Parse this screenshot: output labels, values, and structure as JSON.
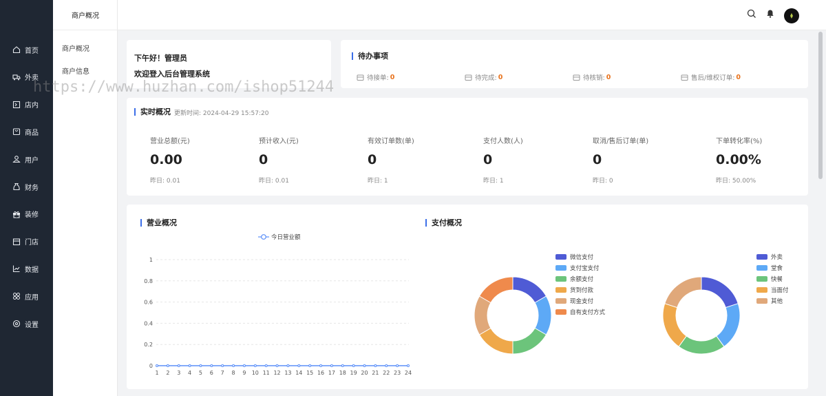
{
  "sidebar": {
    "items": [
      {
        "label": "首页",
        "icon": "home-icon"
      },
      {
        "label": "外卖",
        "icon": "delivery-icon"
      },
      {
        "label": "店内",
        "icon": "store-icon"
      },
      {
        "label": "商品",
        "icon": "bag-icon"
      },
      {
        "label": "用户",
        "icon": "user-icon"
      },
      {
        "label": "财务",
        "icon": "finance-icon"
      },
      {
        "label": "装修",
        "icon": "gift-icon"
      },
      {
        "label": "门店",
        "icon": "shop-icon"
      },
      {
        "label": "数据",
        "icon": "chart-icon"
      },
      {
        "label": "应用",
        "icon": "apps-icon"
      },
      {
        "label": "设置",
        "icon": "gear-icon"
      }
    ]
  },
  "subnav": {
    "title": "商户概况",
    "items": [
      "商户概况",
      "商户信息"
    ]
  },
  "greeting": {
    "line1": "下午好！管理员",
    "line2": "欢迎登入后台管理系统"
  },
  "todo": {
    "title": "待办事项",
    "items": [
      {
        "label": "待接单:",
        "value": "0"
      },
      {
        "label": "待完成:",
        "value": "0"
      },
      {
        "label": "待核销:",
        "value": "0"
      },
      {
        "label": "售后/维权订单:",
        "value": "0"
      }
    ]
  },
  "realtime": {
    "title": "实时概况",
    "updated": "更新时间:  2024-04-29 15:57:20",
    "stats": [
      {
        "label": "营业总额(元)",
        "value": "0.00",
        "yesterday": "昨日:  0.01"
      },
      {
        "label": "预计收入(元)",
        "value": "0",
        "yesterday": "昨日:  0.01"
      },
      {
        "label": "有效订单数(单)",
        "value": "0",
        "yesterday": "昨日:  1"
      },
      {
        "label": "支付人数(人)",
        "value": "0",
        "yesterday": "昨日:  1"
      },
      {
        "label": "取消/售后订单(单)",
        "value": "0",
        "yesterday": "昨日:  0"
      },
      {
        "label": "下单转化率(%)",
        "value": "0.00%",
        "yesterday": "昨日:  50.00%"
      }
    ]
  },
  "business": {
    "title": "营业概况"
  },
  "payment": {
    "title": "支付概况"
  },
  "watermark": "https://www.huzhan.com/ishop51244",
  "colors": {
    "accent": "#3b6ee8",
    "sidebar": "#1f2733",
    "orange": "#e8721c"
  },
  "chart_data": [
    {
      "type": "line",
      "title": "",
      "legend": [
        "今日营业额"
      ],
      "x": [
        1,
        2,
        3,
        4,
        5,
        6,
        7,
        8,
        9,
        10,
        11,
        12,
        13,
        14,
        15,
        16,
        17,
        18,
        19,
        20,
        21,
        22,
        23,
        24
      ],
      "series": [
        {
          "name": "今日营业额",
          "values": [
            0,
            0,
            0,
            0,
            0,
            0,
            0,
            0,
            0,
            0,
            0,
            0,
            0,
            0,
            0,
            0,
            0,
            0,
            0,
            0,
            0,
            0,
            0,
            0
          ]
        }
      ],
      "yticks": [
        "0",
        "0.2",
        "0.4",
        "0.6",
        "0.8",
        "1"
      ],
      "ylim": [
        0,
        1
      ],
      "legend_position": "top",
      "color": "#5b8ff9"
    },
    {
      "type": "pie",
      "style": "donut",
      "categories": [
        "微信支付",
        "支付宝支付",
        "余额支付",
        "货到付款",
        "现金支付",
        "自有支付方式"
      ],
      "values": [
        1,
        1,
        1,
        1,
        1,
        1
      ],
      "colors": [
        "#4f5bd5",
        "#5da9f6",
        "#6cc47b",
        "#efa84a",
        "#e0a87a",
        "#ef8a4c"
      ],
      "legend_position": "top-left"
    },
    {
      "type": "pie",
      "style": "donut",
      "categories": [
        "外卖",
        "堂食",
        "快餐",
        "当面付",
        "其他"
      ],
      "values": [
        1,
        1,
        1,
        1,
        1
      ],
      "colors": [
        "#4f5bd5",
        "#5da9f6",
        "#6cc47b",
        "#efa84a",
        "#e0a87a"
      ],
      "legend_position": "top-right"
    }
  ]
}
